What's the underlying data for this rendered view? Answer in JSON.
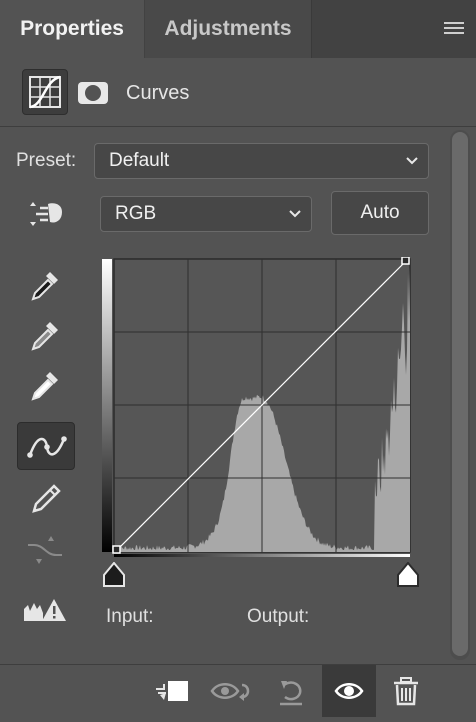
{
  "tabs": [
    {
      "label": "Properties"
    },
    {
      "label": "Adjustments"
    }
  ],
  "header": {
    "title": "Curves"
  },
  "preset": {
    "label": "Preset:",
    "value": "Default"
  },
  "channel": {
    "value": "RGB"
  },
  "auto_label": "Auto",
  "readout": {
    "input_label": "Input:",
    "output_label": "Output:"
  },
  "colors": {
    "panel": "#535353",
    "tabbar": "#424242",
    "histogram": "#a8a8a8",
    "curve": "#ffffff"
  },
  "icons": [
    "panel-menu-icon",
    "curves-adjustment-icon",
    "layer-mask-icon",
    "on-image-adjust-icon",
    "black-point-eyedropper-icon",
    "gray-point-eyedropper-icon",
    "white-point-eyedropper-icon",
    "curve-points-icon",
    "pencil-draw-icon",
    "smooth-curve-icon",
    "clipping-warning-icon",
    "clip-to-layer-icon",
    "view-previous-state-icon",
    "reset-icon",
    "visibility-eye-icon",
    "delete-trash-icon"
  ]
}
